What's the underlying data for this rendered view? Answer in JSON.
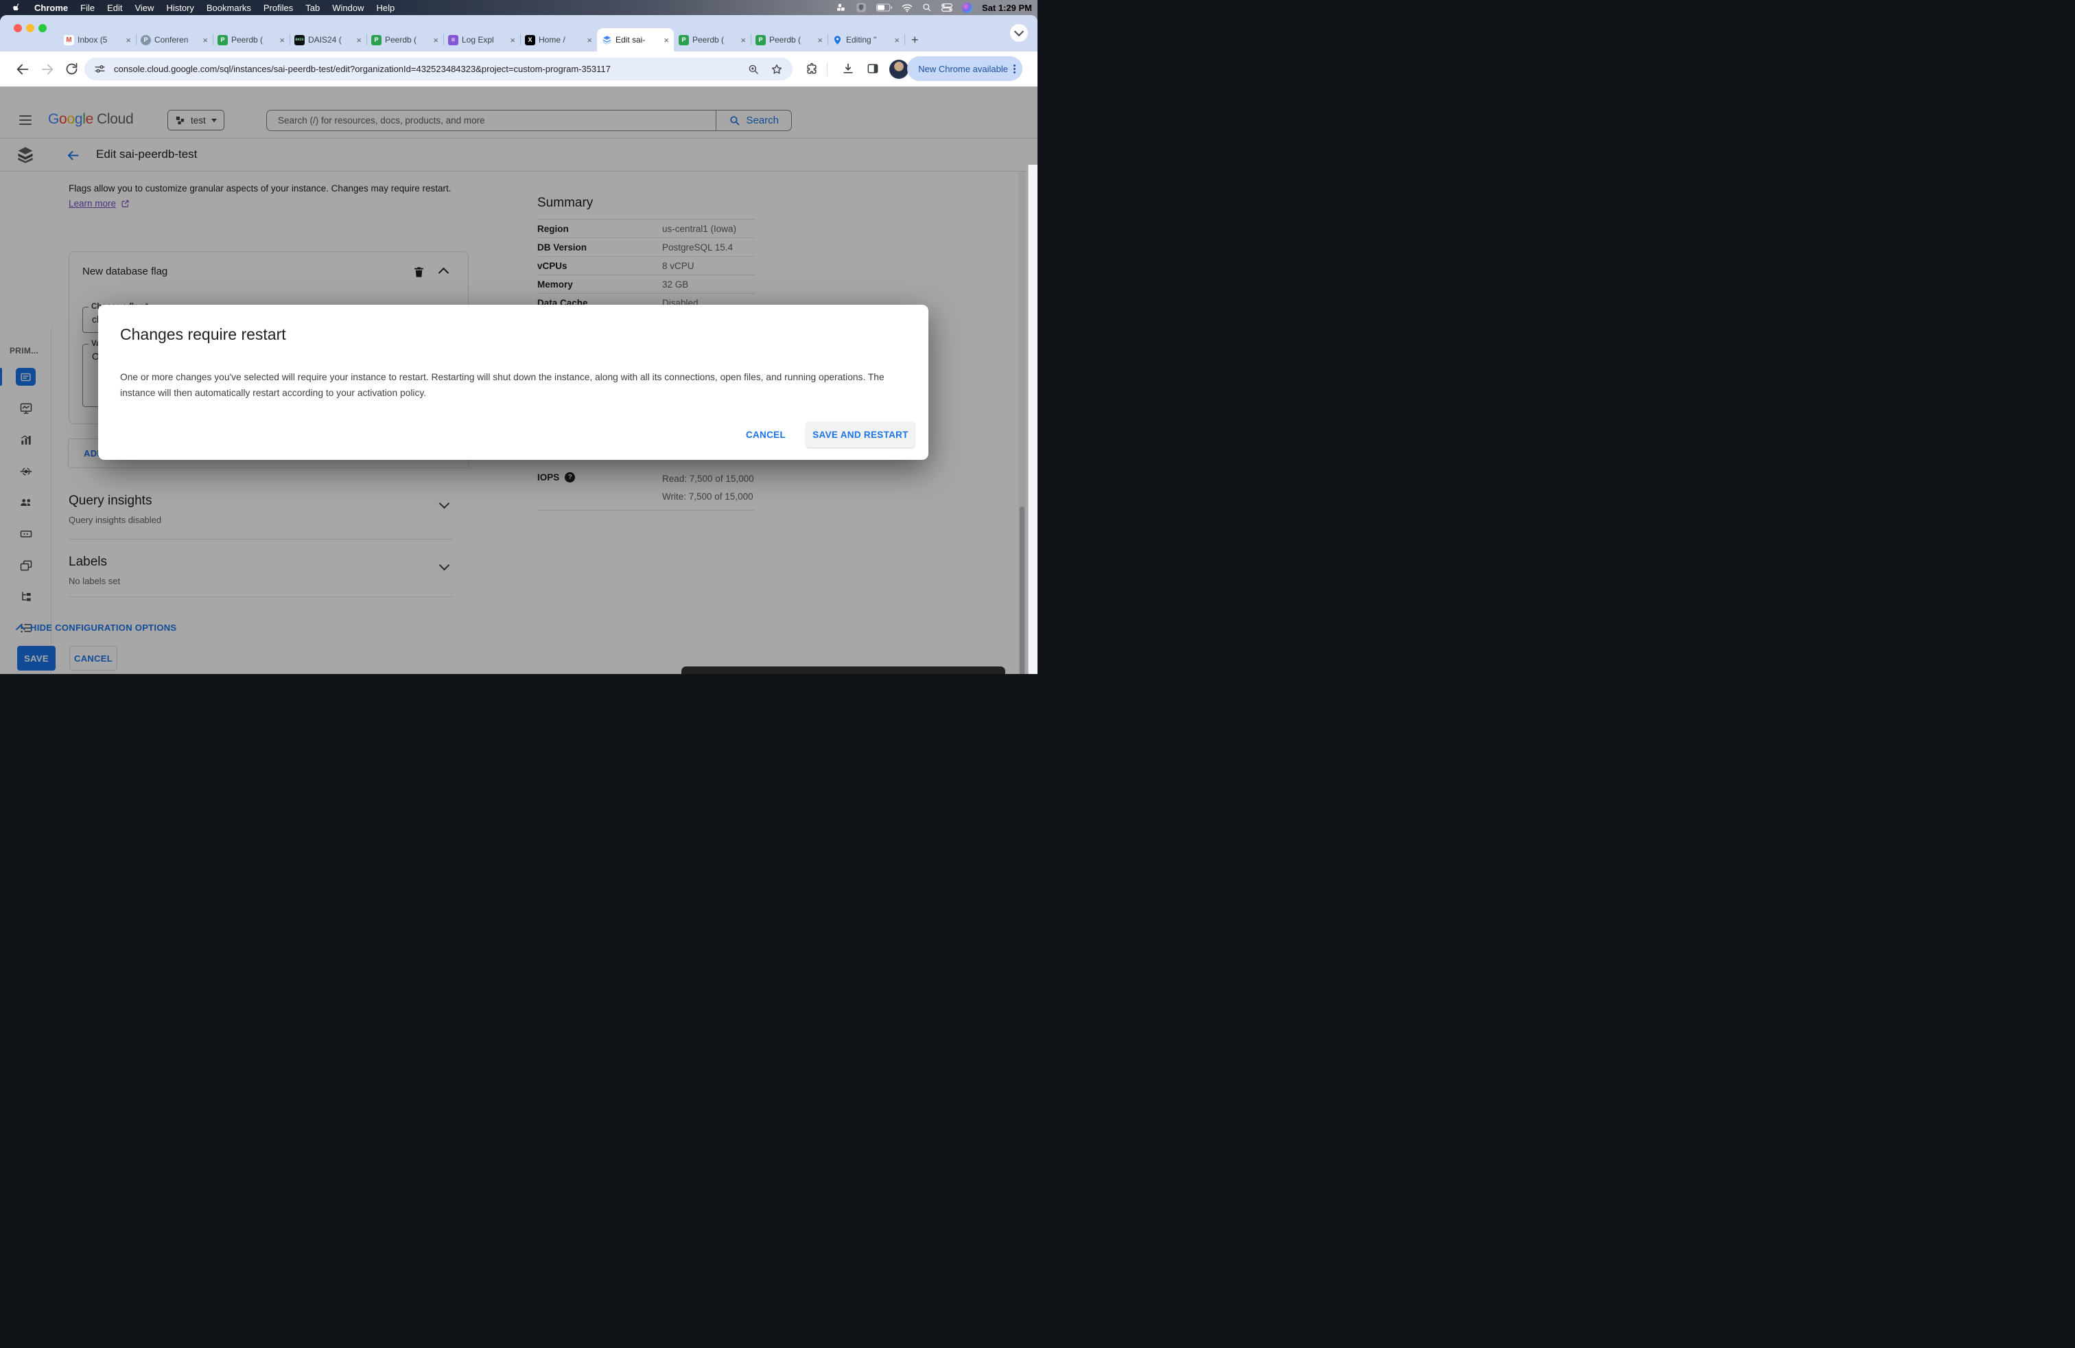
{
  "colors": {
    "accent_blue": "#1a73e8",
    "link_purple": "#7c4dbd",
    "tab_strip": "#cfdaf3",
    "scrim": "rgba(0,0,0,0.345)",
    "save_fill": "#1a73e8"
  },
  "menubar": {
    "items": [
      "Chrome",
      "File",
      "Edit",
      "View",
      "History",
      "Bookmarks",
      "Profiles",
      "Tab",
      "Window",
      "Help"
    ],
    "time": "Sat 1:29 PM"
  },
  "browser": {
    "tabs": [
      {
        "label": "Inbox (5"
      },
      {
        "label": "Conferen"
      },
      {
        "label": "Peerdb ("
      },
      {
        "label": "DAIS24 ("
      },
      {
        "label": "Peerdb ("
      },
      {
        "label": "Log Expl"
      },
      {
        "label": "Home /"
      },
      {
        "label": "Edit sai-"
      },
      {
        "label": "Peerdb ("
      },
      {
        "label": "Peerdb ("
      },
      {
        "label": "Editing \""
      }
    ],
    "close_glyph": "×",
    "new_tab_glyph": "+",
    "gmail_glyph": "M",
    "postgres_glyph": "P",
    "peerdb_glyph": "P",
    "dais_glyph": "DAIS",
    "logs_glyph": "≡",
    "x_glyph": "X",
    "url": "console.cloud.google.com/sql/instances/sai-peerdb-test/edit?organizationId=432523484323&project=custom-program-353117",
    "update_chip": "New Chrome available"
  },
  "gcp": {
    "logo_letters": [
      [
        "G",
        "#4285F4"
      ],
      [
        "o",
        "#EA4335"
      ],
      [
        "o",
        "#FBBC04"
      ],
      [
        "g",
        "#4285F4"
      ],
      [
        "l",
        "#34A853"
      ],
      [
        "e",
        "#EA4335"
      ]
    ],
    "logo_cloud": "Cloud",
    "project": "test",
    "search_placeholder": "Search (/) for resources, docs, products, and more",
    "search_button": "Search",
    "page_title": "Edit sai-peerdb-test"
  },
  "sidebar": {
    "section": "PRIM..."
  },
  "content": {
    "flags_text": "Flags allow you to customize granular aspects of your instance. Changes may require restart.",
    "learn_more": "Learn more",
    "card": {
      "title": "New database flag",
      "flag_label": "Choose a flag *",
      "flag_value": "cloudsql.logical_decoding",
      "value_label": "Val",
      "value_value": "On",
      "add_label": "ADD"
    },
    "query_insights_title": "Query insights",
    "query_insights_sub": "Query insights disabled",
    "labels_title": "Labels",
    "labels_sub": "No labels set",
    "hide_config": "HIDE CONFIGURATION OPTIONS",
    "save": "SAVE",
    "cancel": "CANCEL"
  },
  "summary": {
    "title": "Summary",
    "rows": [
      {
        "label": "Region",
        "value": "us-central1 (Iowa)"
      },
      {
        "label": "DB Version",
        "value": "PostgreSQL 15.4"
      },
      {
        "label": "vCPUs",
        "value": "8 vCPU"
      },
      {
        "label": "Memory",
        "value": "32 GB"
      },
      {
        "label": "Data Cache",
        "value": "Disabled"
      }
    ],
    "iops_label": "IOPS",
    "iops_help": "?",
    "iops_read": "Read: 7,500 of 15,000",
    "iops_write": "Write: 7,500 of 15,000"
  },
  "modal": {
    "title": "Changes require restart",
    "body": "One or more changes you've selected will require your instance to restart. Restarting will shut down the instance, along with all its connections, open files, and running operations. The instance will then automatically restart according to your activation policy.",
    "cancel": "CANCEL",
    "confirm": "SAVE AND RESTART"
  }
}
